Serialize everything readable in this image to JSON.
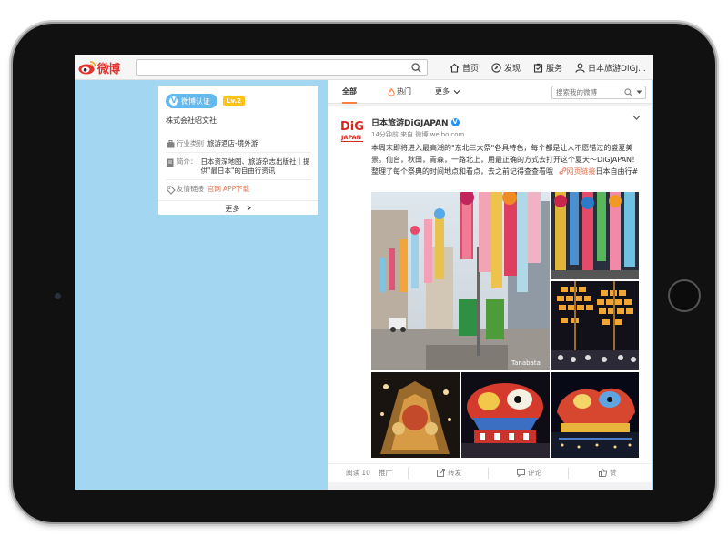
{
  "app": {
    "logo_text": "微博",
    "search_placeholder": ""
  },
  "nav": {
    "home": "首页",
    "discover": "发现",
    "service": "服务",
    "user": "日本旅游DiGJ..."
  },
  "profile": {
    "verify_label": "微博认证",
    "level_label": "Lv.2",
    "company": "株式会社昭文社",
    "industry_key": "行业类别",
    "industry_value": "旅游酒店-境外游",
    "intro_key": "简介：",
    "intro_value": "日本资深地图、旅游杂志出版社｜提供\"最日本\"的自由行资讯",
    "links_key": "友情链接",
    "link_official": "官网",
    "link_app": "APP下载",
    "more_label": "更多"
  },
  "feed": {
    "tab_all": "全部",
    "tab_hot": "热门",
    "tab_more": "更多",
    "search_placeholder": "搜索我的微博"
  },
  "post": {
    "avatar_text_top": "DiG",
    "avatar_text_bottom": "JAPAN",
    "username": "日本旅游DiGJAPAN",
    "time": "14分钟前",
    "source_prefix": "来自",
    "source": "微博 weibo.com",
    "text_main": "本周末即将进入最高潮的\"东北三大祭\"各具特色，每个都是让人不愿错过的盛夏美景。仙台，秋田，青森，一路北上，用最正确的方式去打开这个夏天～DiGJAPAN！整理了每个祭典的时间地点和看点，去之前记得查查看哦",
    "link_label": "网页链接",
    "hashtag": "日本自由行#",
    "photo_caption": "Tanabata"
  },
  "actions": {
    "read": "阅读 10",
    "promote": "推广",
    "repost": "转发",
    "comment": "评论",
    "like": "赞"
  },
  "colors": {
    "background": "#a3d6f1",
    "brand_red": "#e5302b",
    "accent_orange": "#ff8140",
    "link_orange": "#eb7350",
    "verify_blue": "#63b8ee",
    "level_yellow": "#ffc21b"
  }
}
